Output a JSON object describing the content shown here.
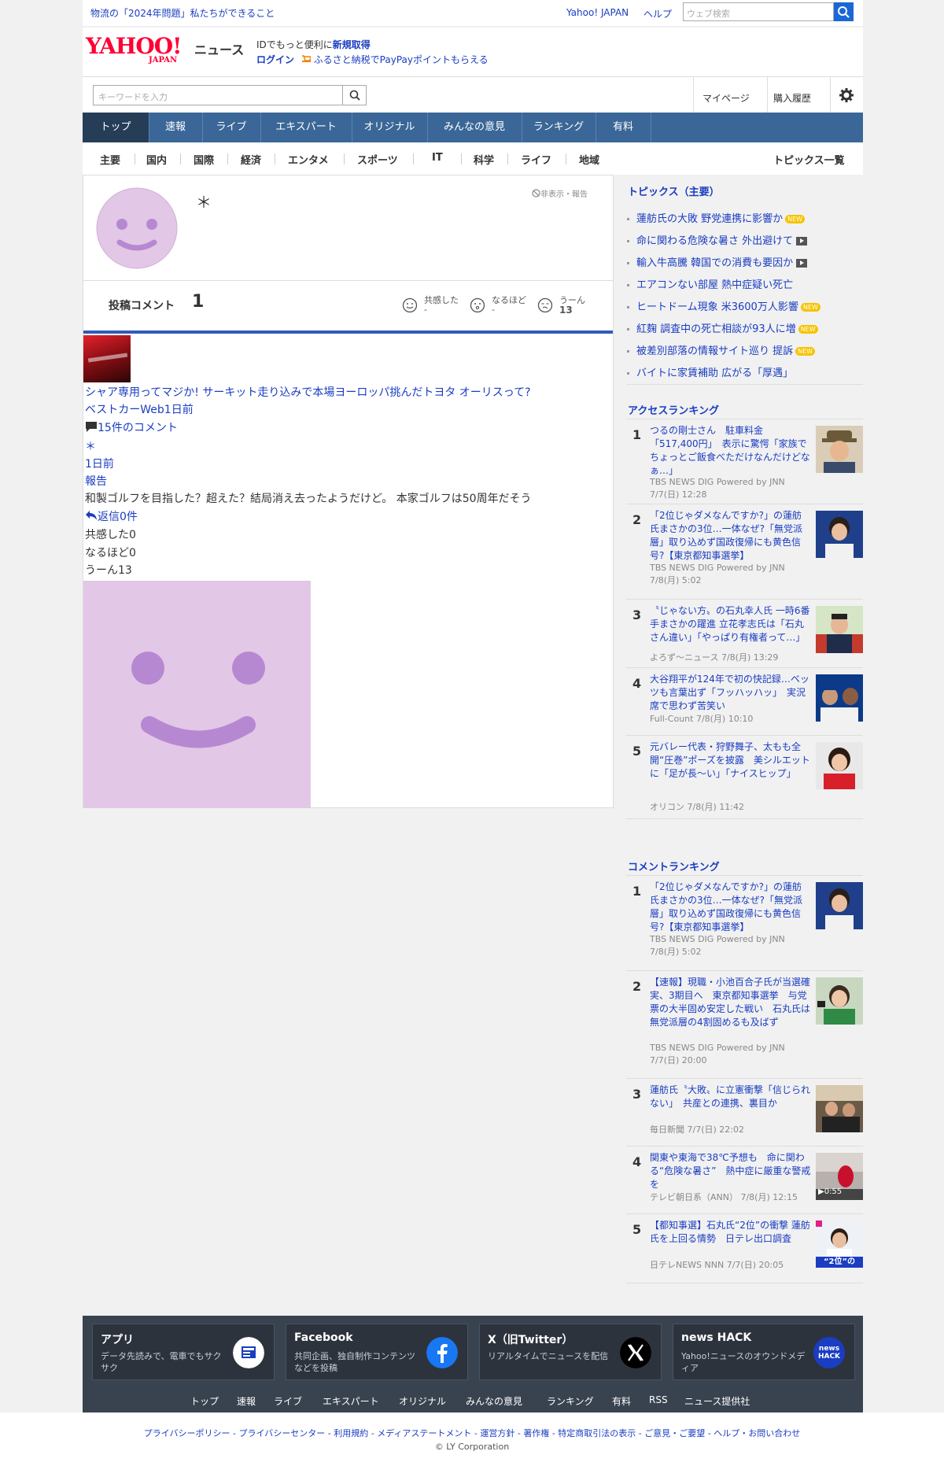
{
  "topbar": {
    "promo": "物流の「2024年問題」私たちができること",
    "yahoo_japan": "Yahoo! JAPAN",
    "help": "ヘルプ",
    "web_search_placeholder": "ウェブ検索"
  },
  "header": {
    "logo_text": "YAHOO!",
    "logo_sub": "JAPAN",
    "service": "ニュース",
    "id_prefix": "IDでもっと便利に",
    "signup": "新規取得",
    "login": "ログイン",
    "furusato": "ふるさと納税でPayPayポイントもらえる"
  },
  "searchbar": {
    "placeholder": "キーワードを入力",
    "mypage": "マイページ",
    "history": "購入履歴"
  },
  "nav": {
    "tabs": [
      "トップ",
      "速報",
      "ライブ",
      "エキスパート",
      "オリジナル",
      "みんなの意見",
      "ランキング",
      "有料"
    ]
  },
  "subnav": {
    "items": [
      "主要",
      "国内",
      "国際",
      "経済",
      "エンタメ",
      "スポーツ",
      "IT",
      "科学",
      "ライフ",
      "地域"
    ],
    "topics_list": "トピックス一覧"
  },
  "profile": {
    "name": "＊",
    "hide_report": "非表示・報告",
    "posted_label": "投稿コメント",
    "posted_count": "1",
    "empathy_label": "共感した",
    "empathy_value": "-",
    "naruhodo_label": "なるほど",
    "naruhodo_value": "-",
    "uun_label": "うーん",
    "uun_value": "13"
  },
  "comment": {
    "article_title": "シャア専用ってマジか! サーキット走り込みで本場ヨーロッパ挑んだトヨタ オーリスって?",
    "source_time": "ベストカーWeb1日前",
    "comments_count": "15件のコメント",
    "author": "＊",
    "time": "1日前",
    "report": "報告",
    "body": "和製ゴルフを目指した？超えた？結局消え去ったようだけど。 本家ゴルフは50周年だそう",
    "replies": "返信0件",
    "empathy": "共感した0",
    "naruhodo": "なるほど0",
    "uun": "うーん13"
  },
  "sidebar": {
    "topics_heading": "トピックス（主要）",
    "topics": [
      {
        "text": "蓮舫氏の大敗 野党連携に影響か",
        "badge": "NEW"
      },
      {
        "text": "命に関わる危険な暑さ 外出避けて",
        "badge": "video"
      },
      {
        "text": "輸入牛高騰 韓国での消費も要因か",
        "badge": "video"
      },
      {
        "text": "エアコンない部屋 熱中症疑い死亡",
        "badge": ""
      },
      {
        "text": "ヒートドーム現象 米3600万人影響",
        "badge": "NEW"
      },
      {
        "text": "紅麹 調査中の死亡相談が93人に増",
        "badge": "NEW"
      },
      {
        "text": "被差別部落の情報サイト巡り 提訴",
        "badge": "NEW"
      },
      {
        "text": "バイトに家賃補助 広がる「厚遇」",
        "badge": ""
      }
    ],
    "access_heading": "アクセスランキング",
    "access": [
      {
        "num": "1",
        "title": "つるの剛士さん　駐車料金「517,400円」　表示に驚愕「家族でちょっとご飯食べただけなんだけどなぁ…」",
        "src1": "TBS NEWS DIG Powered by JNN",
        "src2": "7/7(日) 12:28"
      },
      {
        "num": "2",
        "title": "「2位じゃダメなんですか?」の蓮舫氏まさかの3位…一体なぜ?「無党派層」取り込めず国政復帰にも黄色信号?【東京都知事選挙】",
        "src1": "TBS NEWS DIG Powered by JNN",
        "src2": "7/8(月) 5:02"
      },
      {
        "num": "3",
        "title": "〝じゃない方〟の石丸幸人氏 一時6番手まさかの躍進 立花孝志氏は「石丸さん違い」「やっぱり有権者って…」",
        "src1": "よろず～ニュース 7/8(月) 13:29",
        "src2": ""
      },
      {
        "num": "4",
        "title": "大谷翔平が124年で初の快記録…ベッツも言葉出ず「フッハッハッ」　実況席で思わず苦笑い",
        "src1": "Full-Count 7/8(月) 10:10",
        "src2": ""
      },
      {
        "num": "5",
        "title": "元バレー代表・狩野舞子、太もも全開“圧巻”ポーズを披露　美シルエットに「足が長～い」「ナイスヒップ」",
        "src1": "オリコン 7/8(月) 11:42",
        "src2": ""
      }
    ],
    "comment_heading": "コメントランキング",
    "comment_rank": [
      {
        "num": "1",
        "title": "「2位じゃダメなんですか?」の蓮舫氏まさかの3位…一体なぜ?「無党派層」取り込めず国政復帰にも黄色信号?【東京都知事選挙】",
        "src1": "TBS NEWS DIG Powered by JNN",
        "src2": "7/8(月) 5:02"
      },
      {
        "num": "2",
        "title": "【速報】現職・小池百合子氏が当選確実、3期目へ　東京都知事選挙　与党票の大半固め安定した戦い　石丸氏は無党派層の4割固めるも及ばず",
        "src1": "TBS NEWS DIG Powered by JNN",
        "src2": "7/7(日) 20:00"
      },
      {
        "num": "3",
        "title": "蓮舫氏〝大敗〟に立憲衝撃「信じられない」　共産との連携、裏目か",
        "src1": "毎日新聞 7/7(日) 22:02",
        "src2": ""
      },
      {
        "num": "4",
        "title": "関東や東海で38℃予想も　命に関わる“危険な暑さ”　熱中症に厳重な警戒を",
        "src1": "テレビ朝日系（ANN） 7/8(月) 12:15",
        "src2": "",
        "duration": "0:55"
      },
      {
        "num": "5",
        "title": "【都知事選】石丸氏“2位”の衝撃 蓮舫氏を上回る情勢　日テレ出口調査",
        "src1": "日テレNEWS NNN 7/7(日) 20:05",
        "src2": "",
        "thumb_text": "“2位”の"
      }
    ]
  },
  "footer": {
    "cards": [
      {
        "title": "アプリ",
        "desc": "データ先読みで、電車でもサクサク",
        "icon": "yahoo-news-app-icon"
      },
      {
        "title": "Facebook",
        "desc": "共同企画、独自制作コンテンツなどを投稿",
        "icon": "facebook-icon"
      },
      {
        "title": "X（旧Twitter）",
        "desc": "リアルタイムでニュースを配信",
        "icon": "x-icon"
      },
      {
        "title": "news HACK",
        "desc": "Yahoo!ニュースのオウンドメディア",
        "icon": "news-hack-icon",
        "icon_text": "news HACK"
      }
    ],
    "links": [
      "トップ",
      "速報",
      "ライブ",
      "エキスパート",
      "オリジナル",
      "みんなの意見",
      "ランキング",
      "有料",
      "RSS",
      "ニュース提供社"
    ],
    "legal": "プライバシーポリシー - プライバシーセンター - 利用規約 - メディアステートメント - 運営方針 - 著作権 - 特定商取引法の表示 - ご意見・ご要望 - ヘルプ・お問い合わせ",
    "copyright": "© LY Corporation"
  },
  "colors": {
    "brand_red": "#ff0033",
    "link_blue": "#1a3dc1",
    "nav_blue": "#3a6797",
    "nav_active": "#263d58",
    "avatar_bg": "#e2c7e6",
    "avatar_face": "#b788d2"
  }
}
